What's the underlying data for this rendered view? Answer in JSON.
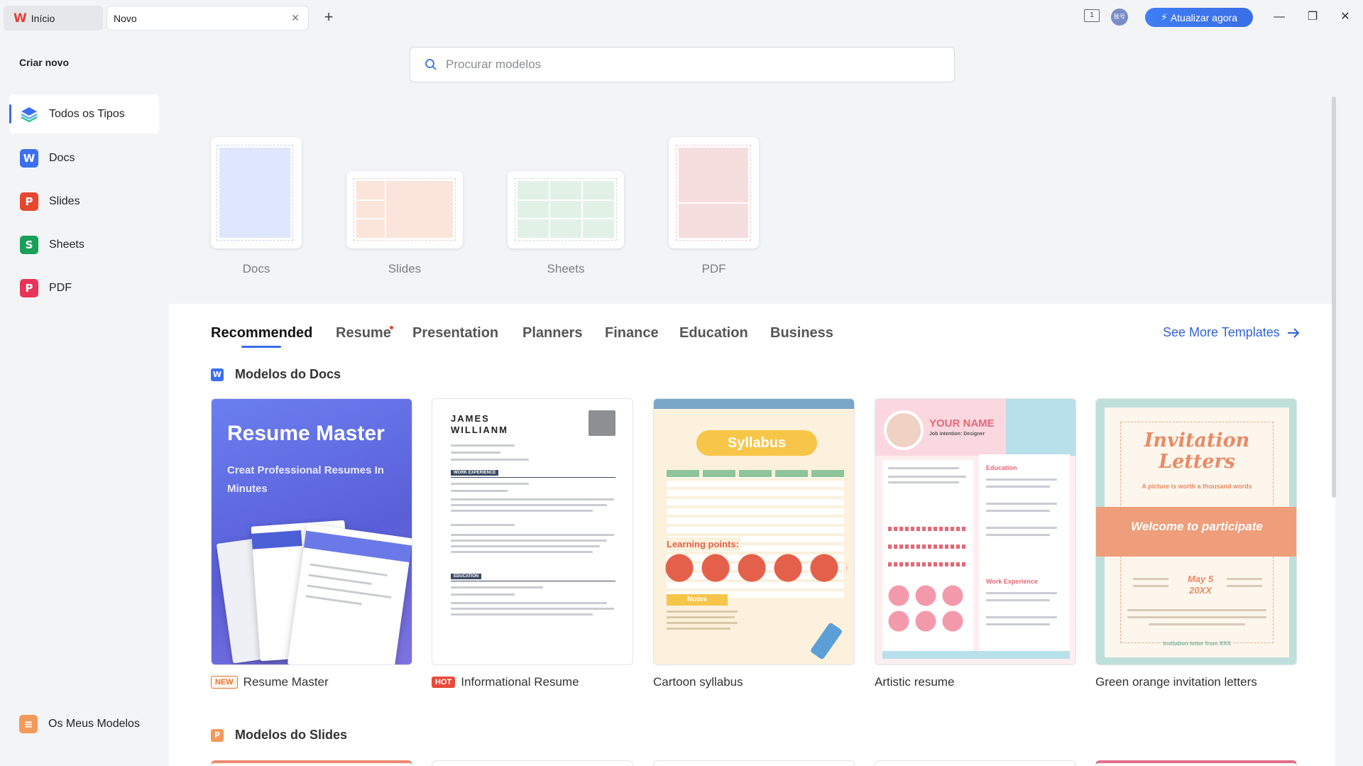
{
  "titlebar": {
    "home_tab": "Início",
    "new_tab": "Novo",
    "upgrade": "Atualizar agora",
    "view_badge": "1",
    "avatar_text": "账号"
  },
  "sidebar": {
    "title": "Criar novo",
    "items": [
      {
        "label": "Todos os Tipos",
        "icon": "layers-icon"
      },
      {
        "label": "Docs",
        "icon": "W"
      },
      {
        "label": "Slides",
        "icon": "P"
      },
      {
        "label": "Sheets",
        "icon": "S"
      },
      {
        "label": "PDF",
        "icon": "P"
      }
    ],
    "my_templates": "Os Meus Modelos"
  },
  "search": {
    "placeholder": "Procurar modelos"
  },
  "blank_docs": [
    {
      "label": "Docs"
    },
    {
      "label": "Slides"
    },
    {
      "label": "Sheets"
    },
    {
      "label": "PDF"
    }
  ],
  "categories": [
    "Recommended",
    "Resume",
    "Presentation",
    "Planners",
    "Finance",
    "Education",
    "Business"
  ],
  "see_more": "See More Templates",
  "sections": {
    "docs": "Modelos do Docs",
    "slides": "Modelos do Slides"
  },
  "templates": [
    {
      "name": "Resume Master",
      "badge": "NEW"
    },
    {
      "name": "Informational Resume",
      "badge": "HOT"
    },
    {
      "name": "Cartoon syllabus",
      "badge": ""
    },
    {
      "name": "Artistic resume",
      "badge": ""
    },
    {
      "name": "Green orange invitation letters",
      "badge": ""
    }
  ],
  "card_text": {
    "c1_title": "Resume Master",
    "c1_sub": "Creat Professional Resumes In Minutes",
    "c2_name": "JAMES WILLIANM",
    "c2_work": "WORK EXPERIENCE",
    "c2_edu": "EDUCATION",
    "c3_title": "Syllabus",
    "c3_points": "Learning points:",
    "c3_notes": "Notes",
    "c4_name": "YOUR NAME",
    "c4_job": "Job intention: Designer",
    "c4_edu": "Education",
    "c4_work": "Work Experience",
    "c5_title": "Invitation Letters",
    "c5_tag": "A picture is worth a thousand words",
    "c5_banner": "Welcome to participate",
    "c5_date": "May 5 20XX",
    "c5_from": "Invitation letter from XXX"
  },
  "colors": {
    "accent": "#3a6ee6",
    "docs": "#3b6ff2",
    "slides": "#e8472f",
    "sheets": "#18a058",
    "pdf": "#e9345a"
  }
}
